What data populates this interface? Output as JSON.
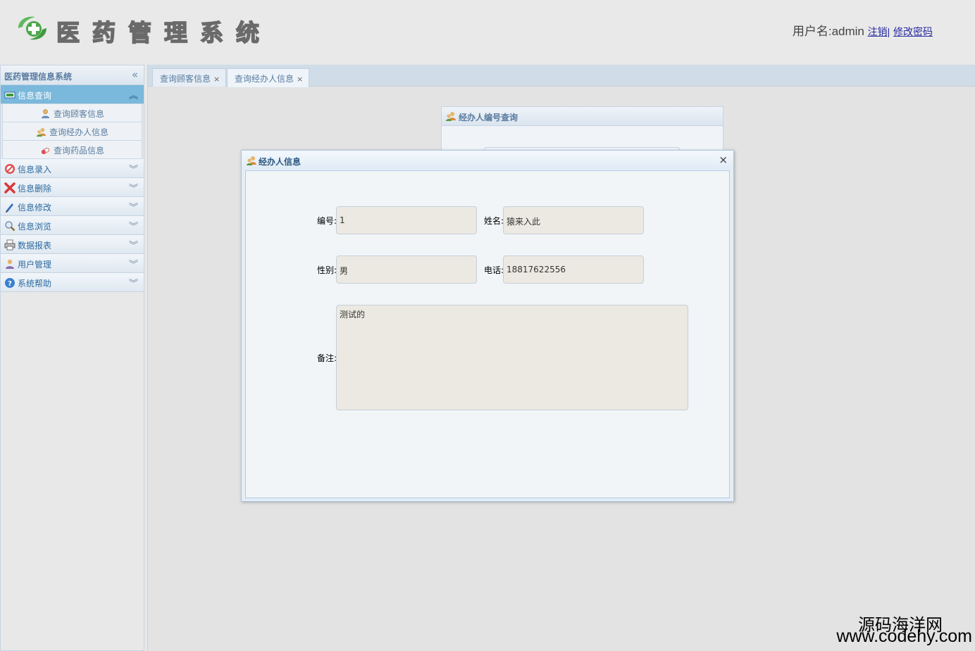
{
  "header": {
    "title": "医药管理系统",
    "user_prefix": "用户名:admin",
    "logout": "注销",
    "separator": "|",
    "change_password": "修改密码"
  },
  "sidebar": {
    "title": "医药管理信息系统",
    "collapse_glyph": "«",
    "sections": [
      {
        "label": "信息查询",
        "icon": "monitor-icon",
        "expanded": true
      },
      {
        "label": "信息录入",
        "icon": "no-entry-icon"
      },
      {
        "label": "信息删除",
        "icon": "delete-x-icon"
      },
      {
        "label": "信息修改",
        "icon": "pencil-icon"
      },
      {
        "label": "信息浏览",
        "icon": "magnifier-icon"
      },
      {
        "label": "数据报表",
        "icon": "printer-icon"
      },
      {
        "label": "用户管理",
        "icon": "user-icon"
      },
      {
        "label": "系统帮助",
        "icon": "help-icon"
      }
    ],
    "sub_items": [
      {
        "label": "查询顾客信息",
        "icon": "customer-icon"
      },
      {
        "label": "查询经办人信息",
        "icon": "agent-icon"
      },
      {
        "label": "查询药品信息",
        "icon": "pill-icon"
      }
    ],
    "chev_up": "︽",
    "chev_down": "︾"
  },
  "tabs": [
    {
      "label": "查询顾客信息",
      "close": "×"
    },
    {
      "label": "查询经办人信息",
      "close": "×",
      "active": true
    }
  ],
  "background_panel": {
    "title": "经办人编号查询"
  },
  "dialog": {
    "title": "经办人信息",
    "close": "×",
    "fields": {
      "id_label": "编号:",
      "id_value": "1",
      "name_label": "姓名:",
      "name_value": "猿来入此",
      "gender_label": "性别:",
      "gender_value": "男",
      "phone_label": "电话:",
      "phone_value": "18817622556",
      "remark_label": "备注:",
      "remark_value": "测试的"
    }
  },
  "watermark": {
    "line1": "源码海洋网",
    "line2": "www.codehy.com"
  },
  "colors": {
    "accent": "#7ab8dc",
    "link": "#2a2aa0",
    "panel_text": "#5a7ca0"
  }
}
